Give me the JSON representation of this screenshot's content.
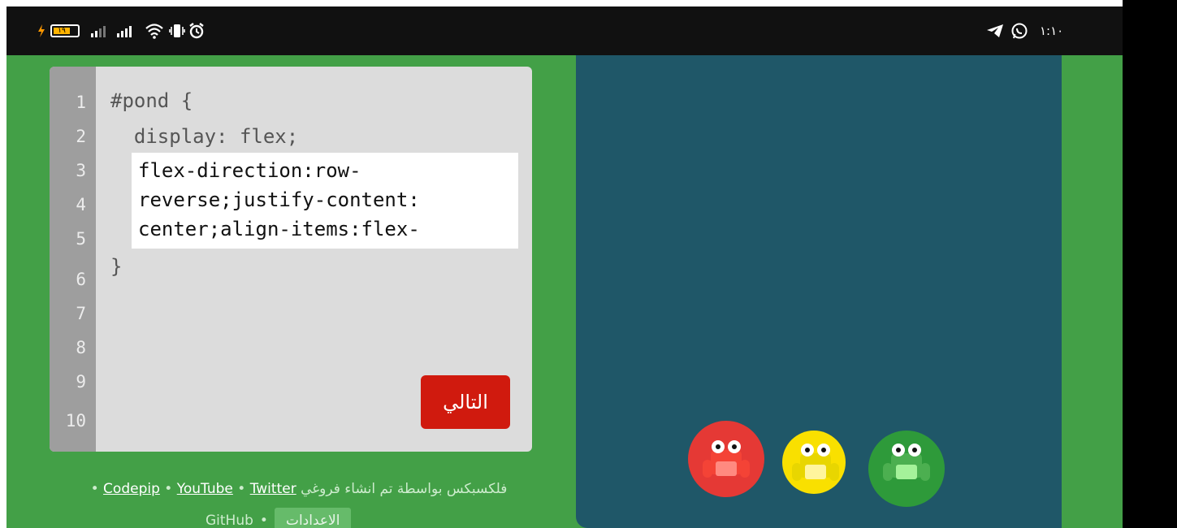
{
  "statusbar": {
    "battery": "١٩",
    "clock": "١:١٠",
    "icons": [
      "charging-icon",
      "battery-icon",
      "signal-icon",
      "wifi-icon",
      "vibrate-icon",
      "alarm-icon",
      "telegram-icon",
      "whatsapp-icon"
    ]
  },
  "editor": {
    "line_numbers": [
      "1",
      "2",
      "3",
      "4",
      "5",
      "6",
      "7",
      "8",
      "9",
      "10"
    ],
    "code_open": "#pond {",
    "code_display": "  display: flex;",
    "code_close": "}",
    "css_input_value": "flex-direction:row-\nreverse;justify-content:\ncenter;align-items:flex-",
    "next_label": "التالي"
  },
  "footer": {
    "credit_text": "فلكسبكس بواسطة",
    "created_text": "تم انشاء فروغي",
    "codepip": "Codepip",
    "youtube": "YouTube",
    "twitter": "Twitter",
    "github": "GitHub",
    "settings": "الاعدادات",
    "sep": "•"
  },
  "pond": {
    "frogs": [
      {
        "name": "red",
        "lily": "#e53935",
        "body": "#f44336",
        "belly": "#ff8a80"
      },
      {
        "name": "yellow",
        "lily": "#f9e000",
        "body": "#e8d600",
        "belly": "#fff59d"
      },
      {
        "name": "green",
        "lily": "#2e9a3a",
        "body": "#4caf50",
        "belly": "#a5f29a"
      }
    ]
  },
  "colors": {
    "background": "#43a047",
    "pond": "#1f5768",
    "editor": "#dcdcdc",
    "gutter": "#9e9e9e",
    "next_button": "#d01a0e"
  }
}
